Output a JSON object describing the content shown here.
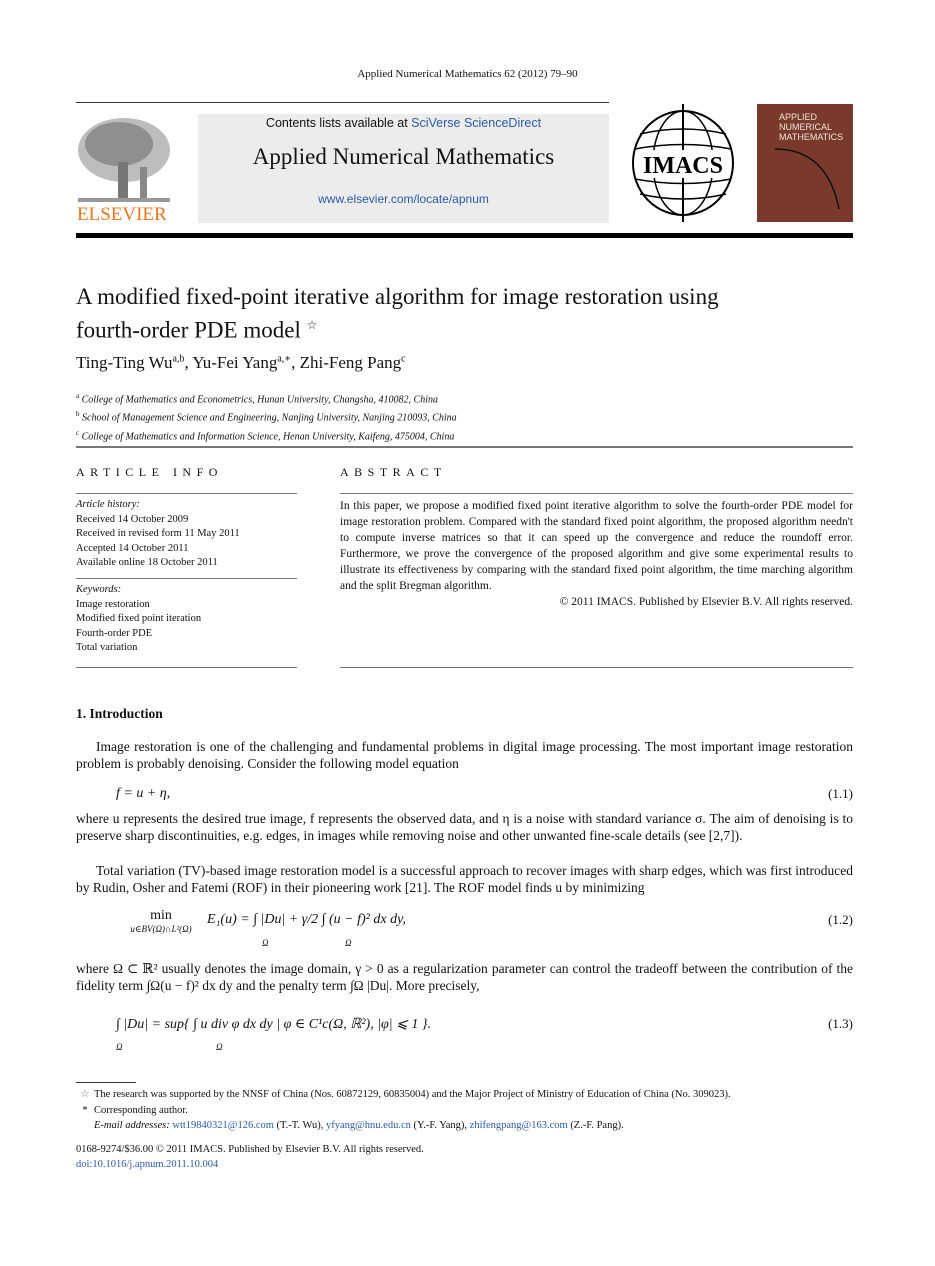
{
  "journal_reference": "Applied Numerical Mathematics 62 (2012) 79–90",
  "banner": {
    "contents_prefix": "Contents lists available at ",
    "contents_link": "SciVerse ScienceDirect",
    "journal_title": "Applied Numerical Mathematics",
    "url": "www.elsevier.com/locate/apnum"
  },
  "logos": {
    "publisher": "ELSEVIER",
    "society": "IMACS",
    "cover_title_lines": [
      "APPLIED",
      "NUMERICAL",
      "MATHEMATICS"
    ]
  },
  "article": {
    "title_line1": "A modified fixed-point iterative algorithm for image restoration using",
    "title_line2": "fourth-order PDE model",
    "title_mark": "☆",
    "authors": [
      {
        "name": "Ting-Ting Wu",
        "sup": "a,b",
        "sep": ", "
      },
      {
        "name": "Yu-Fei Yang",
        "sup": "a,∗",
        "sep": ", "
      },
      {
        "name": "Zhi-Feng Pang",
        "sup": "c",
        "sep": ""
      }
    ],
    "affiliations": [
      {
        "mark": "a",
        "text": "College of Mathematics and Econometrics, Hunan University, Changsha, 410082, China"
      },
      {
        "mark": "b",
        "text": "School of Management Science and Engineering, Nanjing University, Nanjing 210093, China"
      },
      {
        "mark": "c",
        "text": "College of Mathematics and Information Science, Henan University, Kaifeng, 475004, China"
      }
    ]
  },
  "article_info": {
    "heading": "ARTICLE INFO",
    "history_label": "Article history:",
    "history": [
      "Received 14 October 2009",
      "Received in revised form 11 May 2011",
      "Accepted 14 October 2011",
      "Available online 18 October 2011"
    ],
    "keywords_label": "Keywords:",
    "keywords": [
      "Image restoration",
      "Modified fixed point iteration",
      "Fourth-order PDE",
      "Total variation"
    ]
  },
  "abstract": {
    "heading": "ABSTRACT",
    "text": "In this paper, we propose a modified fixed point iterative algorithm to solve the fourth-order PDE model for image restoration problem. Compared with the standard fixed point algorithm, the proposed algorithm needn't to compute inverse matrices so that it can speed up the convergence and reduce the roundoff error. Furthermore, we prove the convergence of the proposed algorithm and give some experimental results to illustrate its effectiveness by comparing with the standard fixed point algorithm, the time marching algorithm and the split Bregman algorithm.",
    "copyright": "© 2011 IMACS. Published by Elsevier B.V. All rights reserved."
  },
  "introduction": {
    "heading": "1. Introduction",
    "p1": "Image restoration is one of the challenging and fundamental problems in digital image processing. The most important image restoration problem is probably denoising. Consider the following model equation",
    "eq1": "f = u + η,",
    "eq1_no": "(1.1)",
    "p2": "where u represents the desired true image, f represents the observed data, and η is a noise with standard variance σ. The aim of denoising is to preserve sharp discontinuities, e.g. edges, in images while removing noise and other unwanted fine-scale details (see [2,7]).",
    "p3": "Total variation (TV)-based image restoration model is a successful approach to recover images with sharp edges, which was first introduced by Rudin, Osher and Fatemi (ROF) in their pioneering work [21]. The ROF model finds u by minimizing",
    "eq2_min": "min",
    "eq2_sub": "u∈BV(Ω)∩L²(Ω)",
    "eq2_body": "E₁(u) = ∫ |Du| + γ/2 ∫ (u − f)² dx dy,",
    "eq2_no": "(1.2)",
    "p4": "where Ω ⊂ ℝ² usually denotes the image domain, γ > 0 as a regularization parameter can control the tradeoff between the contribution of the fidelity term ∫Ω(u − f)² dx dy and the penalty term ∫Ω |Du|. More precisely,",
    "eq3_body": "∫ |Du| = sup{ ∫ u div φ dx dy | φ ∈ C¹c(Ω, ℝ²), |φ| ⩽ 1 }.",
    "eq3_no": "(1.3)",
    "omega": "Ω"
  },
  "footnotes": {
    "star_mark": "☆",
    "star_text": "The research was supported by the NNSF of China (Nos. 60872129, 60835004) and the Major Project of Ministry of Education of China (No. 309023).",
    "corr_mark": "*",
    "corr_text": "Corresponding author.",
    "email_label": "E-mail addresses:",
    "emails": [
      {
        "addr": "wtt19840321@126.com",
        "who": " (T.-T. Wu), "
      },
      {
        "addr": "yfyang@hnu.edu.cn",
        "who": " (Y.-F. Yang), "
      },
      {
        "addr": "zhifengpang@163.com",
        "who": " (Z.-F. Pang)."
      }
    ]
  },
  "bottom": {
    "issn": "0168-9274/$36.00 © 2011 IMACS. Published by Elsevier B.V. All rights reserved.",
    "doi": "doi:10.1016/j.apnum.2011.10.004"
  },
  "colors": {
    "link": "#2b5aa6",
    "elsevier_orange": "#e87722",
    "cover_brown": "#7a3a2b",
    "banner_bg": "#ececec"
  }
}
